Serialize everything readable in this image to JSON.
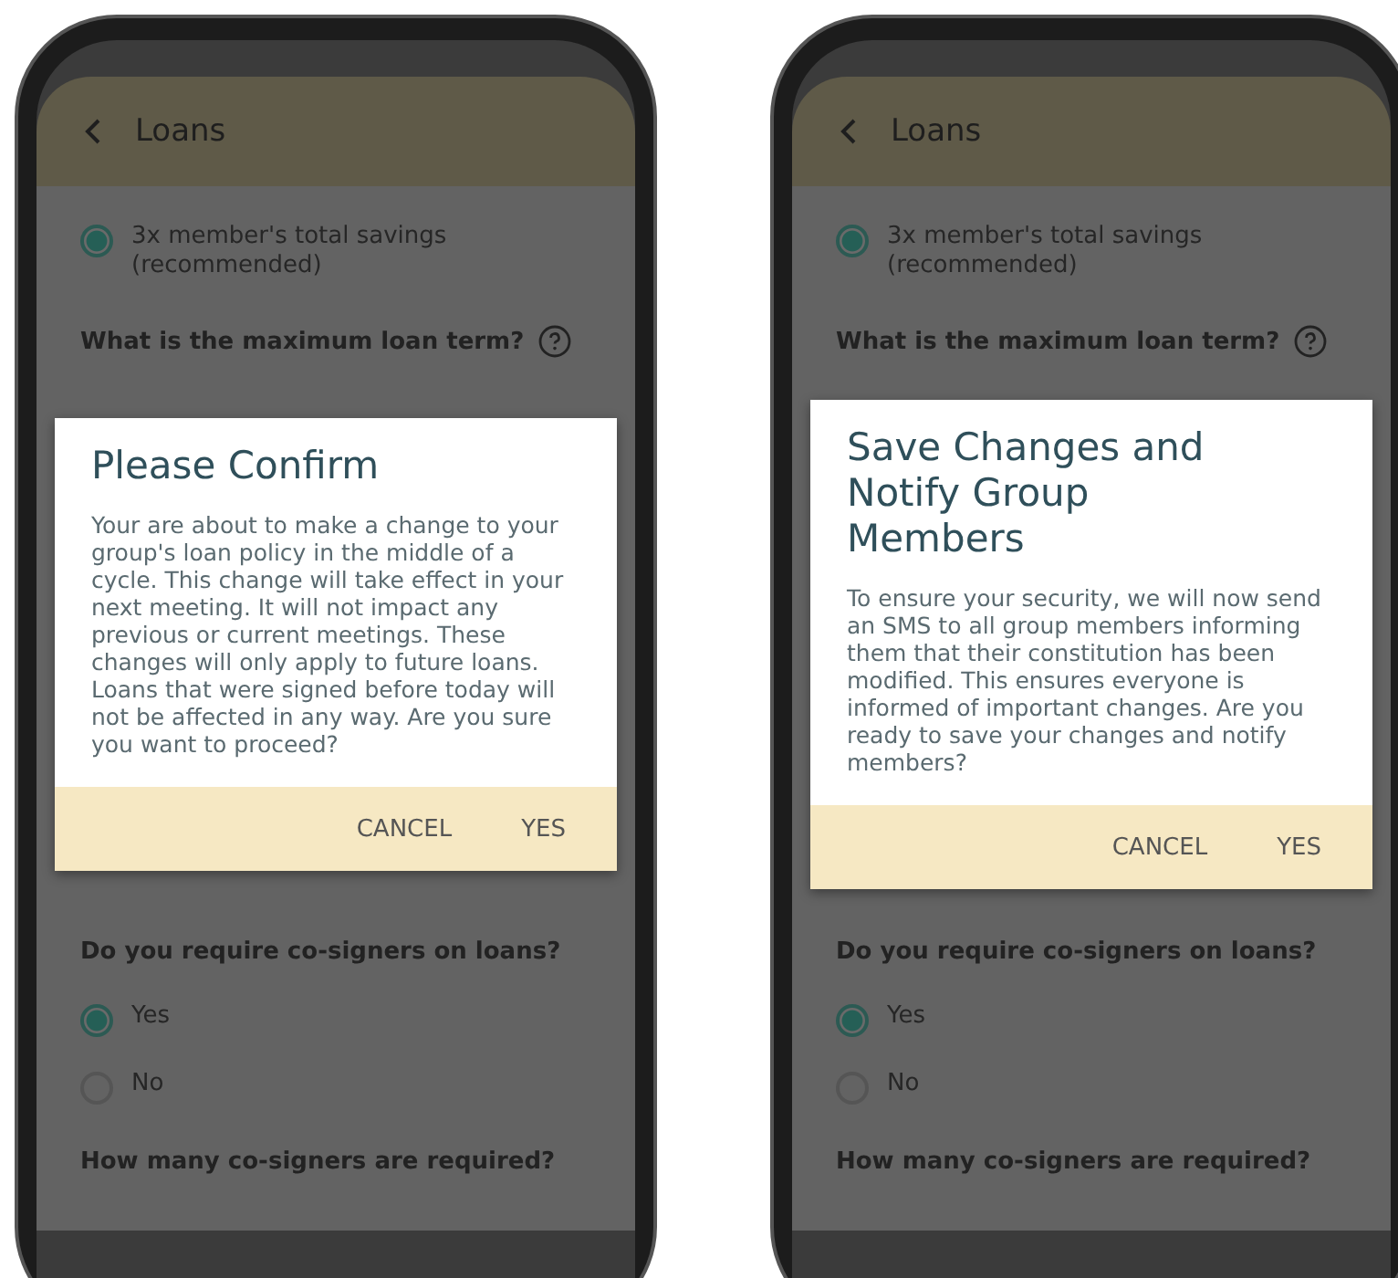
{
  "phones": [
    {
      "header": {
        "title": "Loans"
      },
      "above_dialog": [
        {
          "kind": "radio",
          "label": "3x member's total savings (recommended)",
          "selected": true
        },
        {
          "kind": "question",
          "label": "What is the maximum loan term?",
          "help": true
        }
      ],
      "below_dialog": [
        {
          "kind": "question",
          "label": "Do you require co-signers on loans?",
          "help": false
        },
        {
          "kind": "radio",
          "label": "Yes",
          "selected": true
        },
        {
          "kind": "radio",
          "label": "No",
          "selected": false
        },
        {
          "kind": "question",
          "label": "How many co-signers are required?",
          "help": false
        }
      ],
      "dialog": {
        "title": "Please Confirm",
        "body": "Your are about to make a change to your group's loan policy in the middle of a cycle. This change will take effect in your next meeting. It will not impact any previous or current meetings. These changes will only apply to future loans. Loans that were signed before today will not be affected in any way. Are you sure you want to proceed?",
        "buttons": [
          "CANCEL",
          "YES"
        ]
      }
    },
    {
      "header": {
        "title": "Loans"
      },
      "above_dialog": [
        {
          "kind": "radio",
          "label": "3x member's total savings (recommended)",
          "selected": true
        },
        {
          "kind": "question",
          "label": "What is the maximum loan term?",
          "help": true
        }
      ],
      "below_dialog": [
        {
          "kind": "question",
          "label": "Do you require co-signers on loans?",
          "help": false
        },
        {
          "kind": "radio",
          "label": "Yes",
          "selected": true
        },
        {
          "kind": "radio",
          "label": "No",
          "selected": false
        },
        {
          "kind": "question",
          "label": "How many co-signers are required?",
          "help": false
        }
      ],
      "dialog": {
        "title": "Save Changes and Notify Group Members",
        "body": "To ensure your security, we will now send an SMS to all group members informing them that their constitution has been modified. This ensures everyone is informed of important changes. Are you ready to save your changes and notify members?",
        "buttons": [
          "CANCEL",
          "YES"
        ]
      }
    }
  ]
}
